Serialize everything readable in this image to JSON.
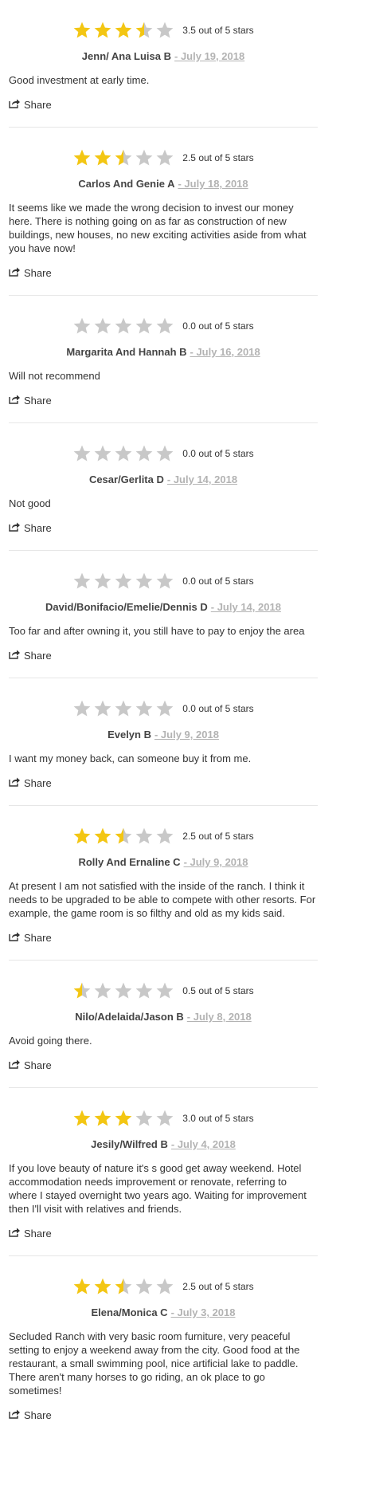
{
  "colors": {
    "star_filled": "#f3c613",
    "star_empty": "#c8c8c8",
    "date": "#b3b3b3"
  },
  "share_label": "Share",
  "share_icon": "share-icon",
  "reviews": [
    {
      "rating": 3.5,
      "rating_text": "3.5 out of 5 stars",
      "author": "Jenn/ Ana Luisa B",
      "date": "- July 19, 2018",
      "text": "Good investment at early time."
    },
    {
      "rating": 2.5,
      "rating_text": "2.5 out of 5 stars",
      "author": "Carlos And Genie A",
      "date": "- July 18, 2018",
      "text": "It seems like we made the wrong decision to invest our money here. There is nothing going on as far as construction of new buildings, new houses, no new exciting activities aside from what you have now!"
    },
    {
      "rating": 0.0,
      "rating_text": "0.0 out of 5 stars",
      "author": "Margarita And Hannah B",
      "date": "- July 16, 2018",
      "text": "Will not recommend"
    },
    {
      "rating": 0.0,
      "rating_text": "0.0 out of 5 stars",
      "author": "Cesar/Gerlita D",
      "date": "- July 14, 2018",
      "text": "Not good"
    },
    {
      "rating": 0.0,
      "rating_text": "0.0 out of 5 stars",
      "author": "David/Bonifacio/Emelie/Dennis D",
      "date": "- July 14, 2018",
      "text": "Too far and after owning it, you still have to pay to enjoy the area"
    },
    {
      "rating": 0.0,
      "rating_text": "0.0 out of 5 stars",
      "author": "Evelyn B",
      "date": "- July 9, 2018",
      "text": "I want my money back, can someone buy it from me."
    },
    {
      "rating": 2.5,
      "rating_text": "2.5 out of 5 stars",
      "author": "Rolly And Ernaline C",
      "date": "- July 9, 2018",
      "text": "At present I am not satisfied with the inside of the ranch. I think it needs to be upgraded to be able to compete with other resorts. For example, the game room is so filthy and old as my kids said."
    },
    {
      "rating": 0.5,
      "rating_text": "0.5 out of 5 stars",
      "author": "Nilo/Adelaida/Jason B",
      "date": "- July 8, 2018",
      "text": "Avoid going there."
    },
    {
      "rating": 3.0,
      "rating_text": "3.0 out of 5 stars",
      "author": "Jesily/Wilfred B",
      "date": "- July 4, 2018",
      "text": "If you love beauty of nature it's s good get away weekend. Hotel accommodation needs improvement or renovate, referring to where I stayed overnight two years ago. Waiting for improvement then I'll visit with relatives and friends."
    },
    {
      "rating": 2.5,
      "rating_text": "2.5 out of 5 stars",
      "author": "Elena/Monica C",
      "date": "- July 3, 2018",
      "text": "Secluded Ranch with very basic room furniture, very peaceful setting to enjoy a weekend away from the city. Good food at the restaurant, a small swimming pool, nice artificial lake to paddle. There aren't many horses to go riding, an ok place to go sometimes!"
    }
  ]
}
